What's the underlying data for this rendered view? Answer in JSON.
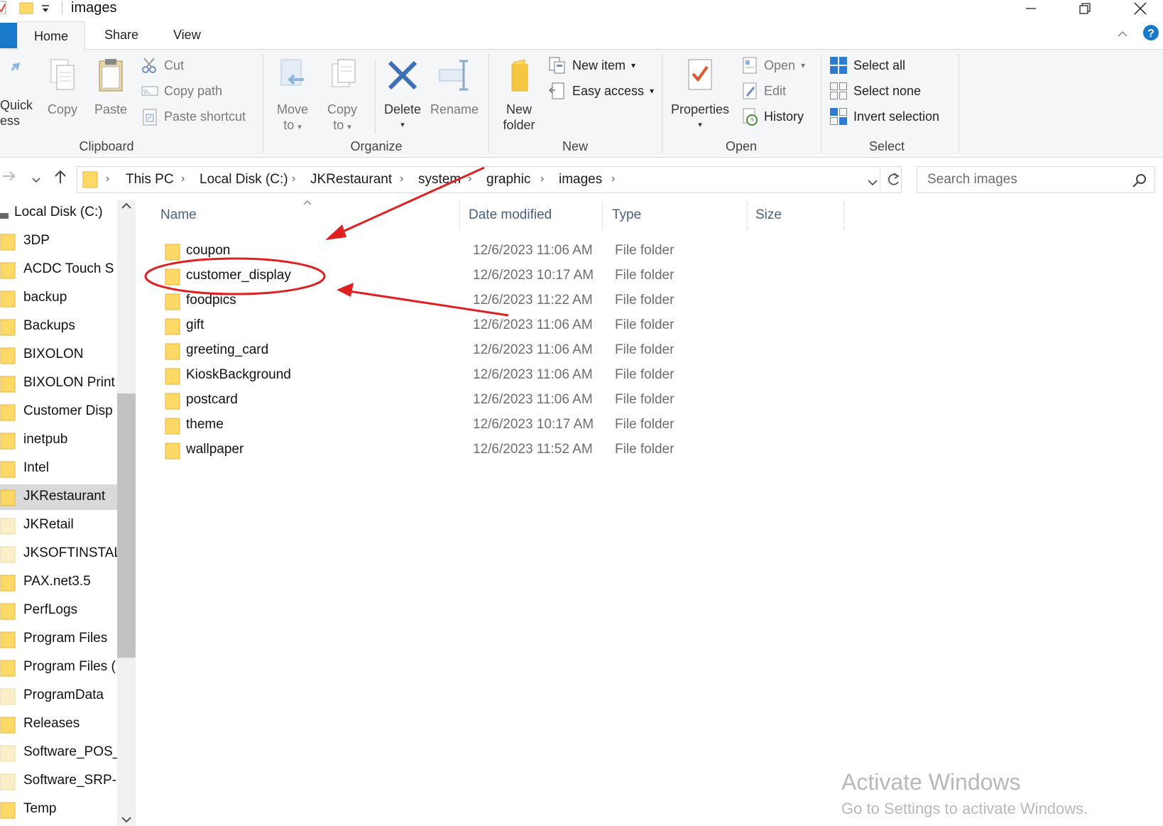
{
  "window": {
    "title": "images",
    "minimize": "—",
    "restore": "❐",
    "close": "✕"
  },
  "tabs": {
    "home": "Home",
    "share": "Share",
    "view": "View"
  },
  "ribbon": {
    "clipboard": {
      "label": "Clipboard",
      "quick_access_line1": "Quick",
      "quick_access_line2": "ess",
      "copy": "Copy",
      "paste": "Paste",
      "cut": "Cut",
      "copy_path": "Copy path",
      "paste_shortcut": "Paste shortcut"
    },
    "organize": {
      "label": "Organize",
      "move_to_line1": "Move",
      "move_to_line2": "to",
      "copy_to_line1": "Copy",
      "copy_to_line2": "to",
      "delete": "Delete",
      "rename": "Rename"
    },
    "new": {
      "label": "New",
      "new_folder_line1": "New",
      "new_folder_line2": "folder",
      "new_item": "New item",
      "easy_access": "Easy access"
    },
    "open": {
      "label": "Open",
      "properties": "Properties",
      "open": "Open",
      "edit": "Edit",
      "history": "History"
    },
    "select": {
      "label": "Select",
      "select_all": "Select all",
      "select_none": "Select none",
      "invert_selection": "Invert selection"
    }
  },
  "address": {
    "crumbs": [
      "This PC",
      "Local Disk (C:)",
      "JKRestaurant",
      "system",
      "graphic",
      "images"
    ],
    "search_placeholder": "Search images"
  },
  "nav_pane": {
    "root": "Local Disk (C:)",
    "items": [
      "3DP",
      "ACDC Touch S",
      "backup",
      "Backups",
      "BIXOLON",
      "BIXOLON Print",
      "Customer Disp",
      "inetpub",
      "Intel",
      "JKRestaurant",
      "JKRetail",
      "JKSOFTINSTAL",
      "PAX.net3.5",
      "PerfLogs",
      "Program Files",
      "Program Files (",
      "ProgramData",
      "Releases",
      "Software_POS_",
      "Software_SRP-:",
      "Temp"
    ],
    "selected": "JKRestaurant"
  },
  "columns": {
    "name": "Name",
    "date": "Date modified",
    "type": "Type",
    "size": "Size"
  },
  "files": [
    {
      "name": "coupon",
      "date": "12/6/2023 11:06 AM",
      "type": "File folder"
    },
    {
      "name": "customer_display",
      "date": "12/6/2023 10:17 AM",
      "type": "File folder"
    },
    {
      "name": "foodpics",
      "date": "12/6/2023 11:22 AM",
      "type": "File folder"
    },
    {
      "name": "gift",
      "date": "12/6/2023 11:06 AM",
      "type": "File folder"
    },
    {
      "name": "greeting_card",
      "date": "12/6/2023 11:06 AM",
      "type": "File folder"
    },
    {
      "name": "KioskBackground",
      "date": "12/6/2023 11:06 AM",
      "type": "File folder"
    },
    {
      "name": "postcard",
      "date": "12/6/2023 11:06 AM",
      "type": "File folder"
    },
    {
      "name": "theme",
      "date": "12/6/2023 10:17 AM",
      "type": "File folder"
    },
    {
      "name": "wallpaper",
      "date": "12/6/2023 11:52 AM",
      "type": "File folder"
    }
  ],
  "watermark": {
    "line1": "Activate Windows",
    "line2": "Go to Settings to activate Windows."
  },
  "colors": {
    "accent": "#1979ca",
    "folder": "#ffd966",
    "annotation": "#e02020"
  }
}
